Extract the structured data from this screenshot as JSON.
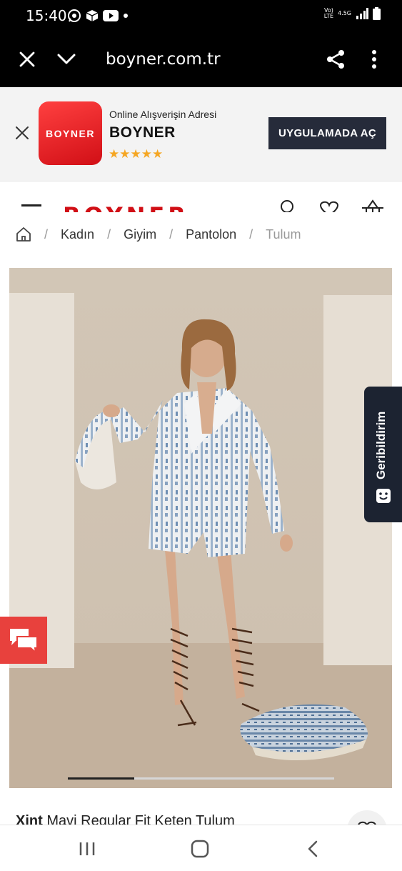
{
  "status_bar": {
    "time": "15:40",
    "network_volte": "Vo))\nLTE",
    "network_type": "4.5G",
    "icons": [
      "whatsapp-icon",
      "package-icon",
      "youtube-icon",
      "dot-icon",
      "signal-icon",
      "battery-icon"
    ]
  },
  "browser": {
    "url": "boyner.com.tr",
    "icons": [
      "close-icon",
      "chevron-down-icon",
      "share-icon",
      "more-vertical-icon"
    ]
  },
  "app_banner": {
    "logo_text": "BOYNER",
    "subtitle": "Online Alışverişin Adresi",
    "name": "BOYNER",
    "stars": "★★★★★",
    "rating": 4.5,
    "open_app_label": "UYGULAMADA AÇ"
  },
  "site_header": {
    "logo_text": "BOYNER",
    "icons": [
      "menu-icon",
      "user-icon",
      "heart-icon",
      "basket-icon"
    ]
  },
  "breadcrumb": {
    "items": [
      "Kadın",
      "Giyim",
      "Pantolon"
    ],
    "current": "Tulum",
    "separator": "/"
  },
  "gallery": {
    "carousel_progress": 0.25
  },
  "feedback_tab": {
    "label": "Geribildirim"
  },
  "product": {
    "brand": "Xint",
    "name": "Mavi Regular Fit Keten Tulum"
  },
  "colors": {
    "brand_red": "#d10f16",
    "banner_button": "#262b3a",
    "feedback_bg": "#1c2331",
    "chat_bg": "#e8413d",
    "star": "#f5a623"
  }
}
